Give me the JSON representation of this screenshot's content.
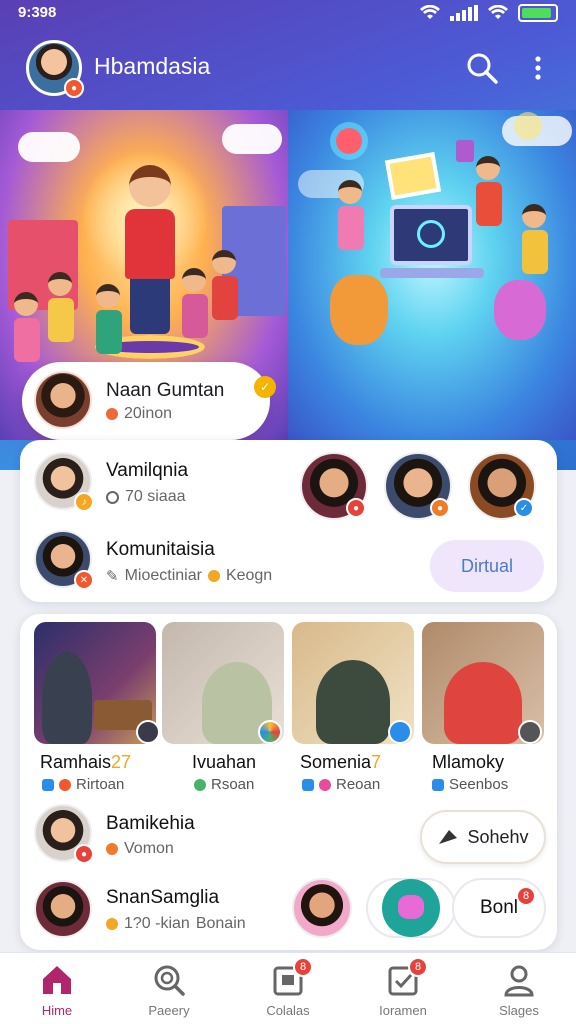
{
  "status_bar": {
    "time": "9:398"
  },
  "app_bar": {
    "title": "Hbamdasia"
  },
  "hero": {
    "host": {
      "name": "Naan Gumtan",
      "sub": "20inon"
    }
  },
  "card1": {
    "row1": {
      "title": "Vamilqnia",
      "sub": "70 siaaa"
    },
    "row2": {
      "title": "Komunitaisia",
      "sub": "Mioectiniar",
      "sub2": "Keogn",
      "button": "Dirtual"
    }
  },
  "tiles": [
    {
      "title": "Ramhais",
      "emoji": "27",
      "sub": "Rirtoan"
    },
    {
      "title": "Ivuahan",
      "emoji": "",
      "sub": "Rsoan"
    },
    {
      "title": "Somenia",
      "emoji": "7",
      "sub": "Reoan"
    },
    {
      "title": "Mlamoky",
      "emoji": "",
      "sub": "Seenbos"
    }
  ],
  "card2": {
    "row3": {
      "title": "Bamikehia",
      "sub": "Vomon",
      "button": "Sohehv"
    },
    "row4": {
      "title": "SnanSamglia",
      "sub": "1?0 -kian",
      "sub2": "Bonain",
      "button": "Bonl"
    }
  },
  "nav": {
    "items": [
      {
        "label": "Hime",
        "icon": "home-icon",
        "badge": ""
      },
      {
        "label": "Paeery",
        "icon": "search-icon",
        "badge": ""
      },
      {
        "label": "Colalas",
        "icon": "clipboard-icon",
        "badge": "8"
      },
      {
        "label": "Ioramen",
        "icon": "check-icon",
        "badge": "8"
      },
      {
        "label": "Slages",
        "icon": "profile-icon",
        "badge": ""
      }
    ]
  },
  "badges": {
    "bonl": "8"
  },
  "colors": {
    "accent": "#b0256b",
    "hero_start": "#5a3fb4",
    "hero_end": "#2e6fd0",
    "notif": "#e8413a",
    "pill_button": "#efe6fb"
  }
}
